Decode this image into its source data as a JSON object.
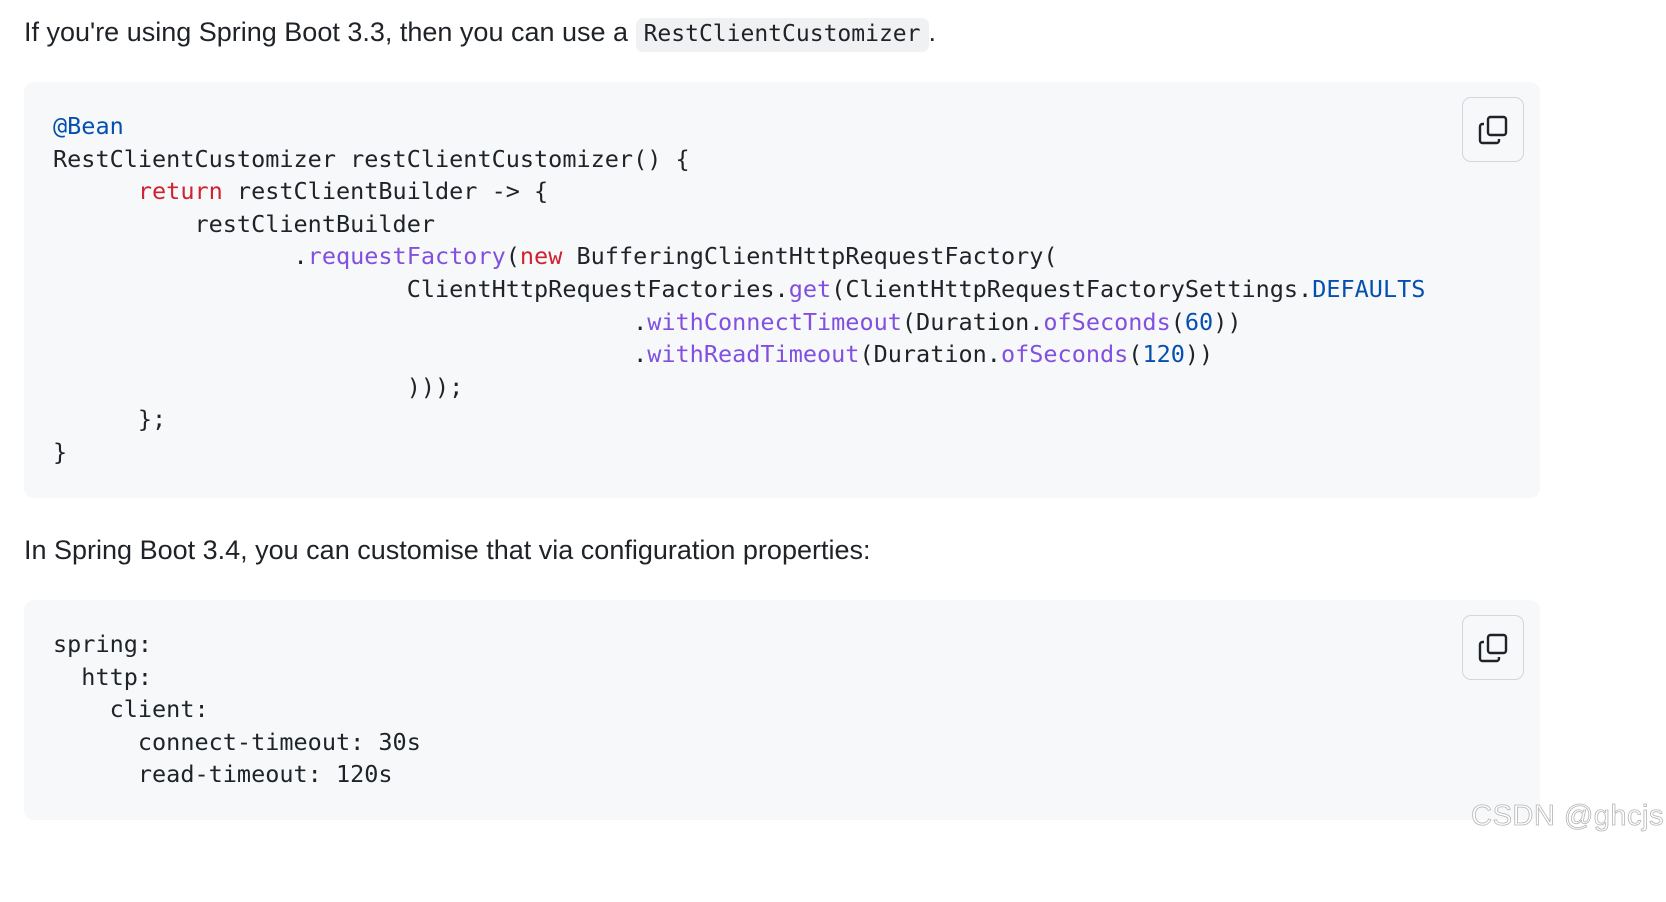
{
  "paragraph1": {
    "text": "If you're using Spring Boot 3.3, then you can use a ",
    "inline_code": "RestClientCustomizer",
    "suffix": "."
  },
  "code_block_1": {
    "language": "java",
    "lines": [
      [
        {
          "t": "@Bean",
          "c": "ann"
        }
      ],
      [
        {
          "t": "RestClientCustomizer restClientCustomizer() {"
        }
      ],
      [
        {
          "t": "      "
        },
        {
          "t": "return",
          "c": "kw"
        },
        {
          "t": " restClientBuilder -> {"
        }
      ],
      [
        {
          "t": "          restClientBuilder"
        }
      ],
      [
        {
          "t": "                 ."
        },
        {
          "t": "requestFactory",
          "c": "fn"
        },
        {
          "t": "("
        },
        {
          "t": "new",
          "c": "kw"
        },
        {
          "t": " BufferingClientHttpRequestFactory("
        }
      ],
      [
        {
          "t": "                         ClientHttpRequestFactories."
        },
        {
          "t": "get",
          "c": "fn"
        },
        {
          "t": "(ClientHttpRequestFactorySettings."
        },
        {
          "t": "DEFAULTS",
          "c": "const"
        }
      ],
      [
        {
          "t": "                                         ."
        },
        {
          "t": "withConnectTimeout",
          "c": "fn"
        },
        {
          "t": "(Duration."
        },
        {
          "t": "ofSeconds",
          "c": "fn"
        },
        {
          "t": "("
        },
        {
          "t": "60",
          "c": "num"
        },
        {
          "t": "))"
        }
      ],
      [
        {
          "t": "                                         ."
        },
        {
          "t": "withReadTimeout",
          "c": "fn"
        },
        {
          "t": "(Duration."
        },
        {
          "t": "ofSeconds",
          "c": "fn"
        },
        {
          "t": "("
        },
        {
          "t": "120",
          "c": "num"
        },
        {
          "t": "))"
        }
      ],
      [
        {
          "t": "                         )));"
        }
      ],
      [
        {
          "t": "      };"
        }
      ],
      [
        {
          "t": "}"
        }
      ]
    ],
    "copy_icon": "copy-icon"
  },
  "paragraph2": {
    "text": "In Spring Boot 3.4, you can customise that via configuration properties:"
  },
  "code_block_2": {
    "language": "yaml",
    "lines": [
      [
        {
          "t": "spring:"
        }
      ],
      [
        {
          "t": "  http:"
        }
      ],
      [
        {
          "t": "    client:"
        }
      ],
      [
        {
          "t": "      connect-timeout: 30s"
        }
      ],
      [
        {
          "t": "      read-timeout: 120s"
        }
      ]
    ],
    "copy_icon": "copy-icon"
  },
  "watermark": "CSDN @ghcjs",
  "colors": {
    "text": "#1f2328",
    "code_bg": "#f6f8fa",
    "keyword": "#cf222e",
    "function": "#8250df",
    "constant": "#0550ae"
  }
}
